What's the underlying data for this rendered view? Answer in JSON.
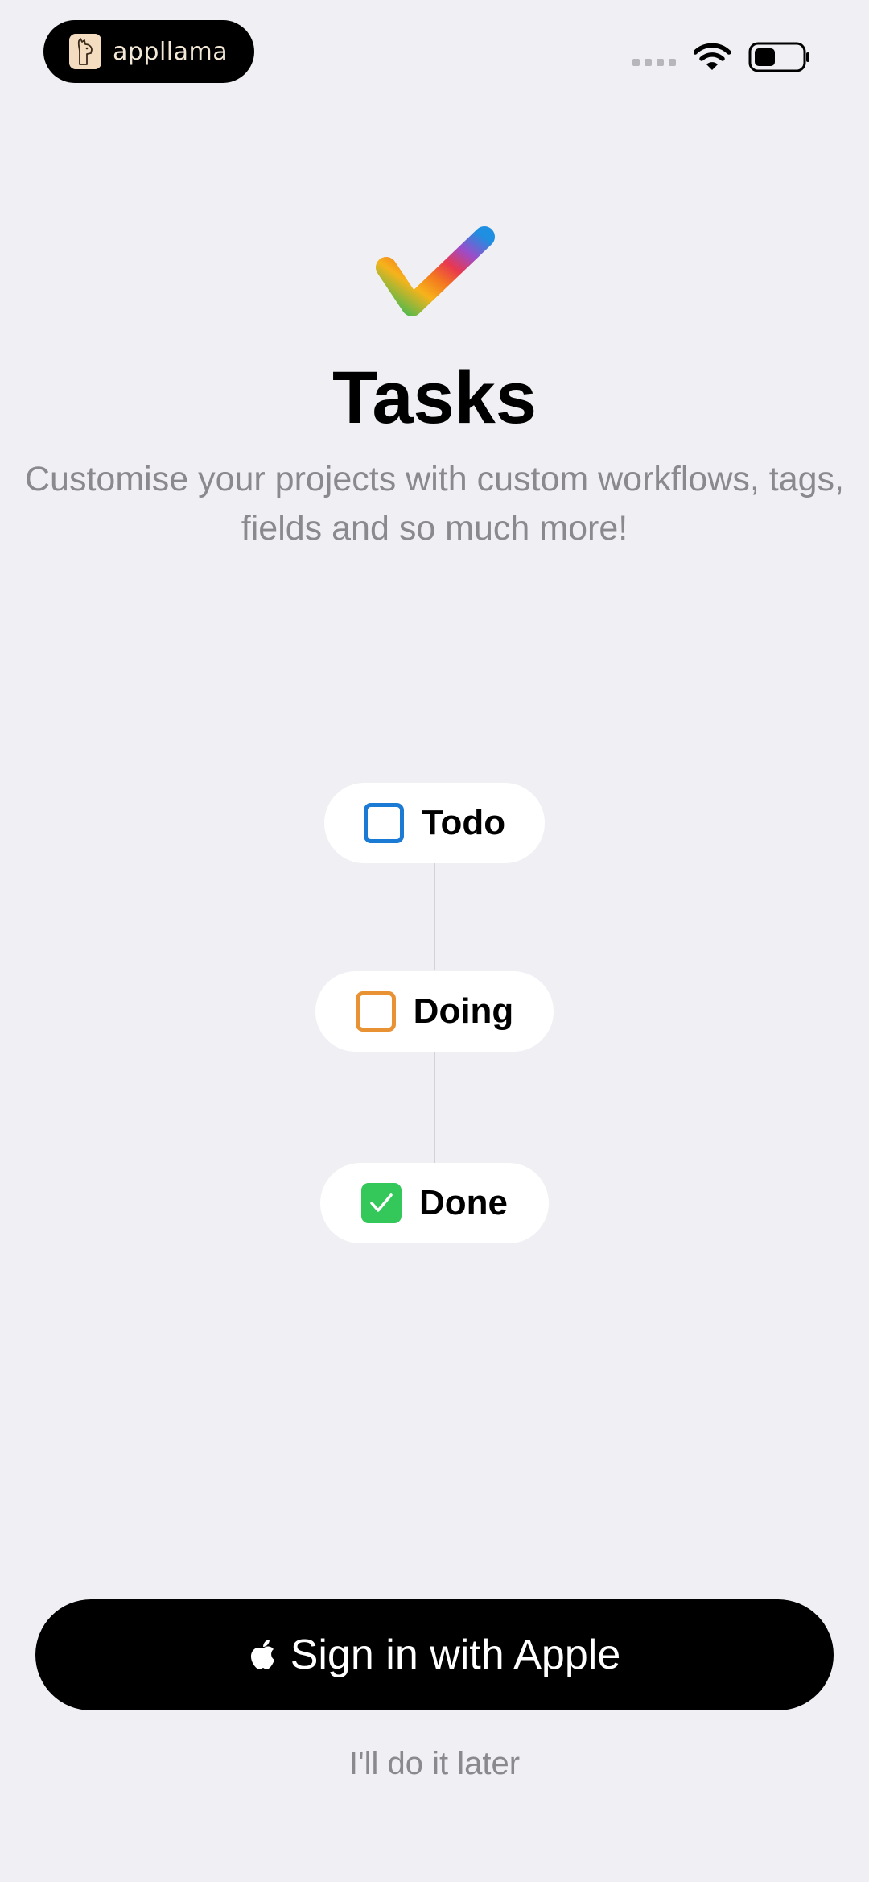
{
  "status_bar": {
    "brand_name": "appllama",
    "brand_icon": "llama-icon"
  },
  "hero": {
    "icon": "rainbow-checkmark-icon",
    "title": "Tasks",
    "subtitle": "Customise your projects with custom workflows, tags, fields and so much more!"
  },
  "workflow": {
    "steps": [
      {
        "label": "Todo",
        "color": "#1a7ad4",
        "state": "unchecked"
      },
      {
        "label": "Doing",
        "color": "#e99234",
        "state": "unchecked"
      },
      {
        "label": "Done",
        "color": "#34c759",
        "state": "checked"
      }
    ]
  },
  "actions": {
    "sign_in_label": "Sign in with Apple",
    "later_label": "I'll do it later"
  }
}
